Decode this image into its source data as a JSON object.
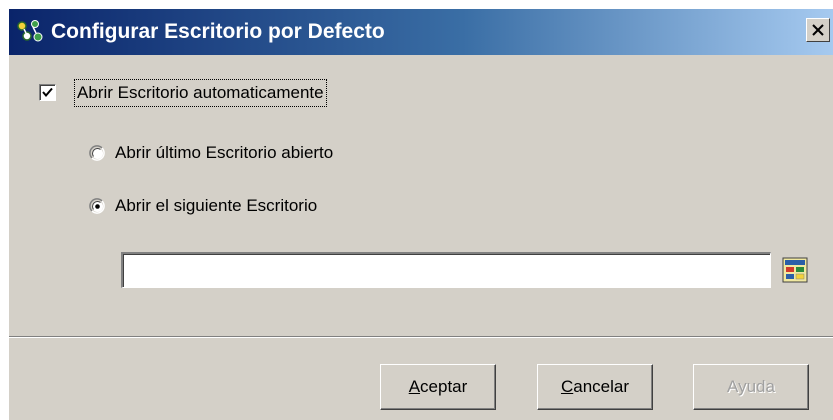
{
  "dialog": {
    "title": "Configurar Escritorio por Defecto",
    "close_label": "×",
    "icon": "desktop-config-icon"
  },
  "options": {
    "auto_open_label": "Abrir Escritorio automaticamente",
    "auto_open_checked": true,
    "radio_last_label": "Abrir último Escritorio abierto",
    "radio_last_selected": false,
    "radio_next_label": "Abrir el siguiente Escritorio",
    "radio_next_selected": true
  },
  "desktop_path": {
    "value": "",
    "placeholder": "",
    "browse_icon": "browse-desktop-icon"
  },
  "buttons": {
    "accept": {
      "mnemonic": "A",
      "rest": "ceptar"
    },
    "cancel": {
      "mnemonic": "C",
      "rest": "ancelar"
    },
    "help": {
      "label": "Ayuda",
      "enabled": false
    }
  },
  "colors": {
    "title_gradient_start": "#0a246a",
    "title_gradient_end": "#a6caf0",
    "dialog_face": "#d4d0c8"
  }
}
